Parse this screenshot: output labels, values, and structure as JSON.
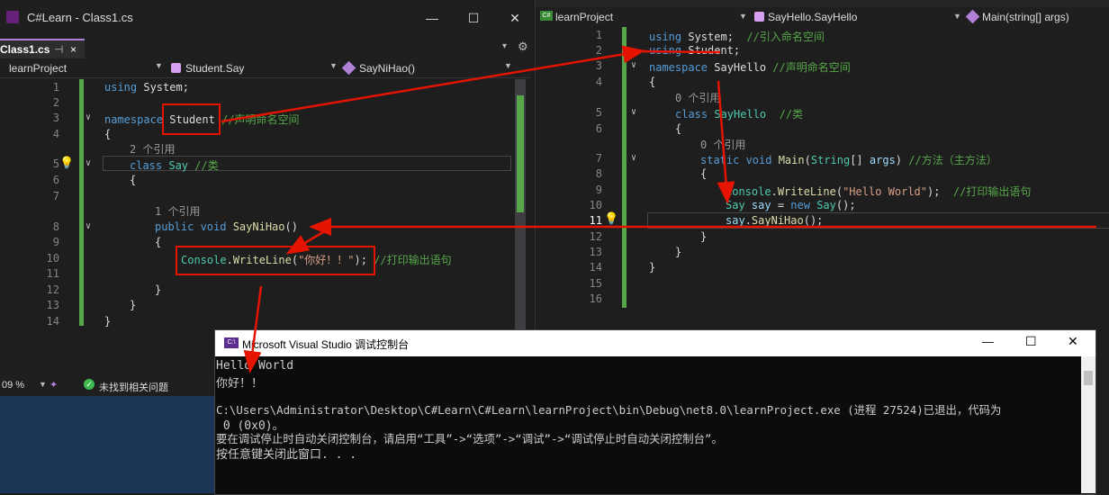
{
  "left": {
    "title": "C#Learn - Class1.cs",
    "tab": {
      "label": "Class1.cs",
      "pin": "⊣",
      "close": "×"
    },
    "nav": {
      "project": "learnProject",
      "class": "Student.Say",
      "method": "SayNiHao()"
    },
    "lines": [
      "1",
      "2",
      "3",
      "4",
      "5",
      "6",
      "7",
      "8",
      "9",
      "10",
      "11",
      "12",
      "13",
      "14"
    ],
    "code": {
      "l1_kw": "using",
      "l1_tx": " System;",
      "l3_kw": "namespace",
      "l3_name": "Student",
      "l3_cm": "//声明命名空间",
      "l4": "{",
      "ref2": "2 个引用",
      "l5_kw": "class",
      "l5_cls": " Say",
      "l5_cm": " //类",
      "l6": "{",
      "ref1": "1 个引用",
      "l8_kw1": "public",
      "l8_kw2": " void",
      "l8_mt": " SayNiHao",
      "l8_tx": "()",
      "l9": "{",
      "l10_cls": "Console",
      "l10_dot": ".",
      "l10_mt": "WriteLine",
      "l10_p1": "(",
      "l10_str": "\"你好！！\"",
      "l10_p2": ");",
      "l10_cm": " //打印输出语句",
      "l12": "}",
      "l13": "}",
      "l14": "}"
    },
    "status": {
      "zoom": "09 %",
      "issues": "未找到相关问题"
    }
  },
  "right": {
    "nav": {
      "project": "learnProject",
      "class": "SayHello.SayHello",
      "method": "Main(string[] args)"
    },
    "lines": [
      "1",
      "2",
      "3",
      "4",
      "5",
      "6",
      "7",
      "8",
      "9",
      "10",
      "11",
      "12",
      "13",
      "14",
      "15",
      "16"
    ],
    "code": {
      "l1_kw": "using",
      "l1_tx": " System;",
      "l1_cm": "  //引入命名空间",
      "l2_kw": "using",
      "l2_tx": " Student;",
      "l3_kw": "namespace",
      "l3_tx": " SayHello",
      "l3_cm": " //声明命名空间",
      "l4": "{",
      "ref0a": "0 个引用",
      "l5_kw": "class",
      "l5_cls": " SayHello",
      "l5_cm": "  //类",
      "l6": "{",
      "ref0b": "0 个引用",
      "l7_kw1": "static",
      "l7_kw2": " void",
      "l7_mt": " Main",
      "l7_p": "(",
      "l7_cls": "String",
      "l7_p2": "[] ",
      "l7_id": "args",
      "l7_p3": ")",
      "l7_cm": " //方法（主方法）",
      "l8": "{",
      "l9_cls": "Console",
      "l9_dot": ".",
      "l9_mt": "WriteLine",
      "l9_p": "(",
      "l9_str": "\"Hello World\"",
      "l9_p2": ");",
      "l9_cm": "  //打印输出语句",
      "l10_cls": "Say",
      "l10_id": " say",
      "l10_tx": " = ",
      "l10_kw": "new",
      "l10_cls2": " Say",
      "l10_p": "();",
      "l11_id": "say",
      "l11_dot": ".",
      "l11_mt": "SayNiHao",
      "l11_p": "();",
      "l12": "}",
      "l13": "}",
      "l14": "}"
    }
  },
  "console": {
    "title": "Microsoft Visual Studio 调试控制台",
    "lines": [
      "Hello World",
      "你好！！",
      "",
      "C:\\Users\\Administrator\\Desktop\\C#Learn\\C#Learn\\learnProject\\bin\\Debug\\net8.0\\learnProject.exe (进程 27524)已退出，代码为",
      " 0 (0x0)。",
      "要在调试停止时自动关闭控制台，请启用“工具”->“选项”->“调试”->“调试停止时自动关闭控制台”。",
      "按任意键关闭此窗口. . ."
    ]
  },
  "window_buttons": {
    "minimize": "—",
    "maximize": "☐",
    "close": "✕"
  },
  "colors": {
    "keyword": "#569cd6",
    "class": "#4ec9b0",
    "string": "#d69d85",
    "comment": "#57a64a",
    "method": "#dcdcaa",
    "arrow": "#e51400"
  }
}
